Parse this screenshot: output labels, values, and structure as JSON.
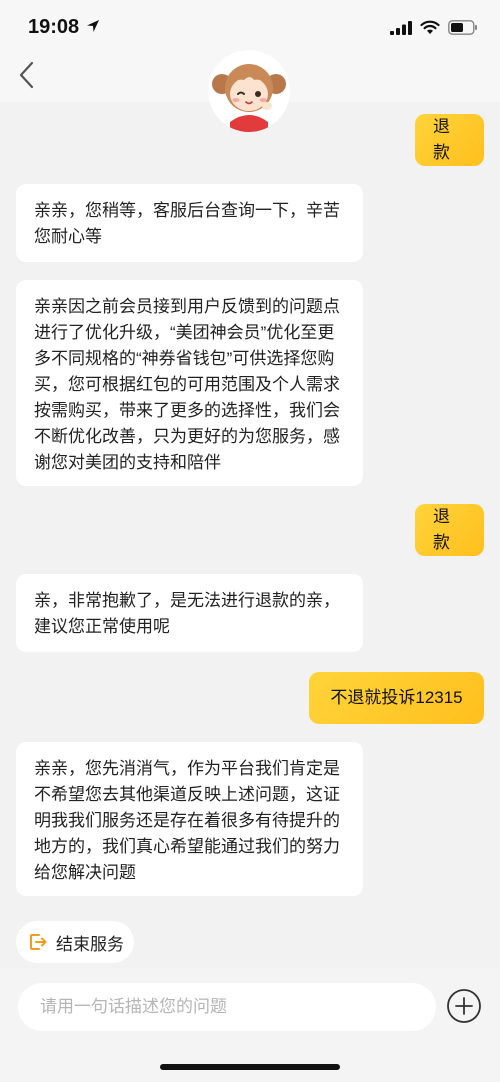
{
  "status_bar": {
    "time": "19:08"
  },
  "messages": [
    {
      "side": "out",
      "text": "退款"
    },
    {
      "side": "in",
      "text": "亲亲，您稍等，客服后台查询一下，辛苦您耐心等"
    },
    {
      "side": "in",
      "text": "亲亲因之前会员接到用户反馈到的问题点进行了优化升级，“美团神会员”优化至更多不同规格的“神券省钱包”可供选择您购买，您可根据红包的可用范围及个人需求按需购买，带来了更多的选择性，我们会不断优化改善，只为更好的为您服务，感谢您对美团的支持和陪伴"
    },
    {
      "side": "out",
      "text": "退款"
    },
    {
      "side": "in",
      "text": "亲，非常抱歉了，是无法进行退款的亲，建议您正常使用呢"
    },
    {
      "side": "out",
      "text": "不退就投诉12315"
    },
    {
      "side": "in",
      "text": "亲亲，您先消消气，作为平台我们肯定是不希望您去其他渠道反映上述问题，这证明我我们服务还是存在着很多有待提升的地方的，我们真心希望能通过我们的努力给您解决问题"
    }
  ],
  "end_service": {
    "label": "结束服务"
  },
  "input": {
    "placeholder": "请用一句话描述您的问题"
  },
  "colors": {
    "accent": "#ffc52b",
    "background": "#f2f2f2"
  }
}
